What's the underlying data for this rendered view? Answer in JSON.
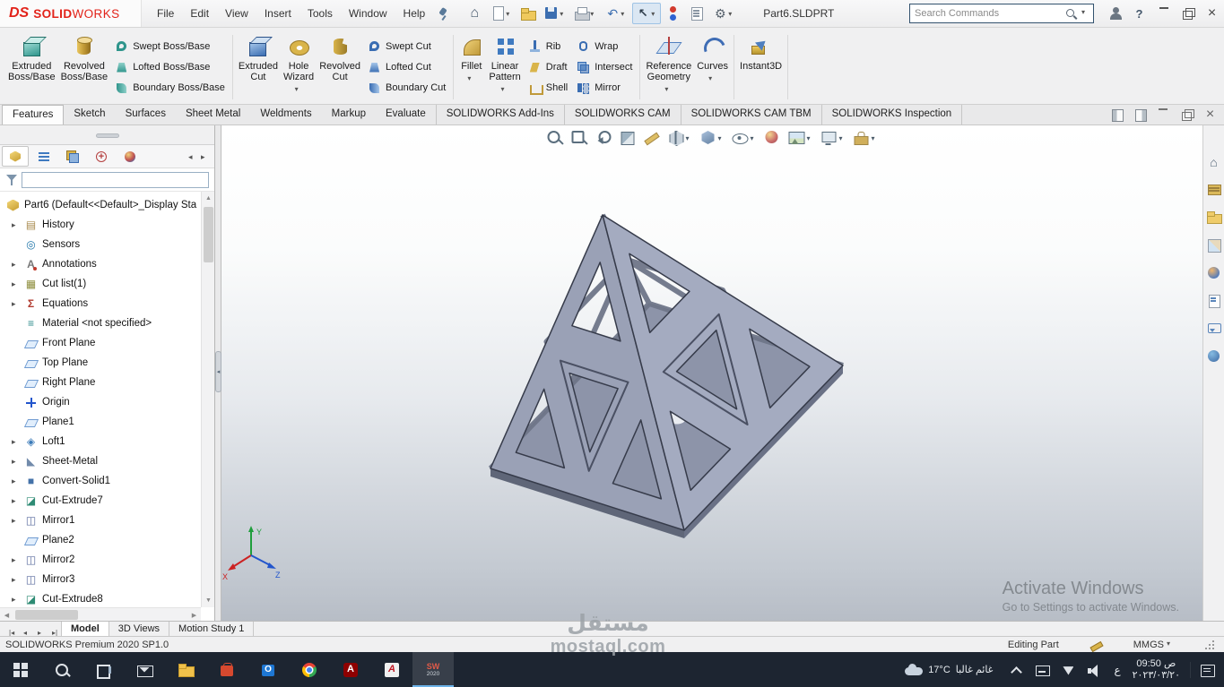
{
  "window": {
    "logo_ds": "DS",
    "logo_solid": "SOLID",
    "logo_works": "WORKS",
    "menus": [
      "File",
      "Edit",
      "View",
      "Insert",
      "Tools",
      "Window",
      "Help"
    ],
    "quick_access": [
      {
        "icon": "home-icon",
        "dropdown": false,
        "active": false
      },
      {
        "icon": "new-document-icon",
        "dropdown": true,
        "active": false
      },
      {
        "icon": "open-icon",
        "dropdown": false,
        "active": false
      },
      {
        "icon": "save-icon",
        "dropdown": true,
        "active": false
      },
      {
        "icon": "print-icon",
        "dropdown": true,
        "active": false
      },
      {
        "icon": "undo-icon",
        "dropdown": true,
        "active": false
      },
      {
        "icon": "select-icon",
        "dropdown": true,
        "active": true
      },
      {
        "icon": "rebuild-icon",
        "dropdown": false,
        "active": false
      },
      {
        "icon": "file-properties-icon",
        "dropdown": false,
        "active": false
      },
      {
        "icon": "options-icon",
        "dropdown": true,
        "active": false
      }
    ],
    "document_title": "Part6.SLDPRT",
    "search_placeholder": "Search Commands",
    "window_controls": [
      "user-account-icon",
      "help-icon",
      "window-minimize-icon",
      "window-restore-icon",
      "window-close-icon"
    ]
  },
  "ribbon": {
    "extruded_boss": {
      "l1": "Extruded",
      "l2": "Boss/Base"
    },
    "revolved_boss": {
      "l1": "Revolved",
      "l2": "Boss/Base"
    },
    "swept_boss": "Swept Boss/Base",
    "lofted_boss": "Lofted Boss/Base",
    "boundary_boss": "Boundary Boss/Base",
    "extruded_cut": {
      "l1": "Extruded",
      "l2": "Cut"
    },
    "hole_wizard": {
      "l1": "Hole",
      "l2": "Wizard"
    },
    "revolved_cut": {
      "l1": "Revolved",
      "l2": "Cut"
    },
    "swept_cut": "Swept Cut",
    "lofted_cut": "Lofted Cut",
    "boundary_cut": "Boundary Cut",
    "fillet": "Fillet",
    "linear_pattern": {
      "l1": "Linear",
      "l2": "Pattern"
    },
    "rib": "Rib",
    "draft": "Draft",
    "shell": "Shell",
    "wrap": "Wrap",
    "intersect": "Intersect",
    "mirror": "Mirror",
    "reference_geometry": {
      "l1": "Reference",
      "l2": "Geometry"
    },
    "curves": "Curves",
    "instant3d": "Instant3D"
  },
  "command_tabs": [
    {
      "label": "Features",
      "active": true,
      "addin": false
    },
    {
      "label": "Sketch",
      "active": false,
      "addin": false
    },
    {
      "label": "Surfaces",
      "active": false,
      "addin": false
    },
    {
      "label": "Sheet Metal",
      "active": false,
      "addin": false
    },
    {
      "label": "Weldments",
      "active": false,
      "addin": false
    },
    {
      "label": "Markup",
      "active": false,
      "addin": false
    },
    {
      "label": "Evaluate",
      "active": false,
      "addin": false
    },
    {
      "label": "SOLIDWORKS Add-Ins",
      "active": false,
      "addin": true
    },
    {
      "label": "SOLIDWORKS CAM",
      "active": false,
      "addin": true
    },
    {
      "label": "SOLIDWORKS CAM TBM",
      "active": false,
      "addin": true
    },
    {
      "label": "SOLIDWORKS Inspection",
      "active": false,
      "addin": true
    }
  ],
  "tab_row_controls": [
    "pane-left-icon",
    "pane-right-icon",
    "window-minimize-icon",
    "window-restore-icon",
    "window-close-icon"
  ],
  "panel": {
    "tabs": [
      {
        "icon": "feature-manager-icon",
        "active": true
      },
      {
        "icon": "property-manager-icon",
        "active": false
      },
      {
        "icon": "configuration-manager-icon",
        "active": false
      },
      {
        "icon": "dimxpert-manager-icon",
        "active": false
      },
      {
        "icon": "display-manager-icon",
        "active": false
      }
    ],
    "feature_tree": {
      "root_label": "Part6 (Default<<Default>_Display Sta",
      "items": [
        {
          "label": "History",
          "icon": "history-folder-icon",
          "arrow": true
        },
        {
          "label": "Sensors",
          "icon": "sensors-icon",
          "arrow": false
        },
        {
          "label": "Annotations",
          "icon": "annotations-icon",
          "arrow": true
        },
        {
          "label": "Cut list(1)",
          "icon": "cut-list-icon",
          "arrow": true
        },
        {
          "label": "Equations",
          "icon": "equations-icon",
          "arrow": true
        },
        {
          "label": "Material <not specified>",
          "icon": "material-icon",
          "arrow": false
        },
        {
          "label": "Front Plane",
          "icon": "plane-icon",
          "arrow": false
        },
        {
          "label": "Top Plane",
          "icon": "plane-icon",
          "arrow": false
        },
        {
          "label": "Right Plane",
          "icon": "plane-icon",
          "arrow": false
        },
        {
          "label": "Origin",
          "icon": "origin-icon",
          "arrow": false
        },
        {
          "label": "Plane1",
          "icon": "plane-icon",
          "arrow": false
        },
        {
          "label": "Loft1",
          "icon": "loft-icon",
          "arrow": true
        },
        {
          "label": "Sheet-Metal",
          "icon": "sheet-metal-icon",
          "arrow": true
        },
        {
          "label": "Convert-Solid1",
          "icon": "convert-solid-icon",
          "arrow": true
        },
        {
          "label": "Cut-Extrude7",
          "icon": "cut-extrude-icon",
          "arrow": true
        },
        {
          "label": "Mirror1",
          "icon": "mirror-feature-icon",
          "arrow": true
        },
        {
          "label": "Plane2",
          "icon": "plane-icon",
          "arrow": false
        },
        {
          "label": "Mirror2",
          "icon": "mirror-feature-icon",
          "arrow": true
        },
        {
          "label": "Mirror3",
          "icon": "mirror-feature-icon",
          "arrow": true
        },
        {
          "label": "Cut-Extrude8",
          "icon": "cut-extrude-icon",
          "arrow": true
        }
      ]
    }
  },
  "headsup": [
    {
      "icon": "zoom-to-fit-icon",
      "dropdown": false
    },
    {
      "icon": "zoom-to-area-icon",
      "dropdown": false
    },
    {
      "icon": "previous-view-icon",
      "dropdown": false
    },
    {
      "icon": "section-view-icon",
      "dropdown": false
    },
    {
      "icon": "dynamic-annotation-views-icon",
      "dropdown": false
    },
    {
      "icon": "view-orientation-icon",
      "dropdown": true
    },
    {
      "icon": "display-style-icon",
      "dropdown": true
    },
    {
      "icon": "hide-show-items-icon",
      "dropdown": true
    },
    {
      "icon": "edit-appearance-icon",
      "dropdown": false
    },
    {
      "icon": "apply-scene-icon",
      "dropdown": true
    },
    {
      "icon": "view-settings-icon",
      "dropdown": true
    },
    {
      "icon": "options-toolbox-icon",
      "dropdown": true
    }
  ],
  "task_pane_icons": [
    "solidworks-resources-icon",
    "design-library-icon",
    "file-explorer-small-icon",
    "view-palette-icon",
    "appearances-scenes-icon",
    "custom-properties-icon",
    "solidworks-forum-icon",
    "3dexperience-icon"
  ],
  "viewport": {
    "axis_labels": {
      "x": "X",
      "y": "Y",
      "z": "Z"
    }
  },
  "watermarks": {
    "activate_title": "Activate Windows",
    "activate_subtitle": "Go to Settings to activate Windows.",
    "brand_arabic": "مستقل",
    "brand_latin": "mostaql.com"
  },
  "model_tabs": [
    {
      "label": "Model",
      "active": true
    },
    {
      "label": "3D Views",
      "active": false
    },
    {
      "label": "Motion Study 1",
      "active": false
    }
  ],
  "status_bar": {
    "product": "SOLIDWORKS Premium 2020 SP1.0",
    "mode": "Editing Part",
    "units": "MMGS"
  },
  "taskbar": {
    "apps": [
      {
        "icon": "start-icon",
        "active": false,
        "label": "",
        "sub": ""
      },
      {
        "icon": "taskbar-search-icon",
        "active": false,
        "label": "",
        "sub": ""
      },
      {
        "icon": "task-view-icon",
        "active": false,
        "label": "",
        "sub": ""
      },
      {
        "icon": "mail-icon",
        "active": false,
        "label": "",
        "sub": ""
      },
      {
        "icon": "explorer-icon",
        "active": false,
        "label": "",
        "sub": ""
      },
      {
        "icon": "store-icon",
        "active": false,
        "label": "",
        "sub": ""
      },
      {
        "icon": "outlook-icon",
        "active": false,
        "label": "",
        "sub": ""
      },
      {
        "icon": "chrome-icon",
        "active": false,
        "label": "",
        "sub": ""
      },
      {
        "icon": "acrobat-icon",
        "active": false,
        "label": "",
        "sub": ""
      },
      {
        "icon": "autocad-icon",
        "active": false,
        "label": "",
        "sub": ""
      },
      {
        "icon": "solidworks-app-icon",
        "active": true,
        "label": "SW",
        "sub": "2020"
      }
    ],
    "weather": {
      "temp": "17°C",
      "condition": "غائم غالبا"
    },
    "tray_icons": [
      "chevron-up-icon",
      "touch-keyboard-icon",
      "wifi-icon",
      "volume-icon"
    ],
    "language": "ع",
    "clock": {
      "time": "09:50 ص",
      "date": "٢٠٢٣/٠٣/٢٠"
    }
  }
}
